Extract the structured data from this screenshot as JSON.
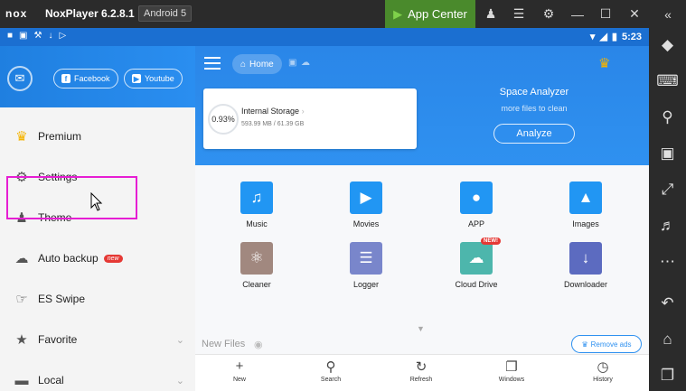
{
  "titlebar": {
    "logo": "nox",
    "title": "NoxPlayer 6.2.8.1",
    "android": "Android 5",
    "app_center": "App Center",
    "icons": [
      "tshirt-icon",
      "menu-icon",
      "gear-icon",
      "minimize-icon",
      "maximize-icon",
      "close-icon",
      "collapse-icon"
    ]
  },
  "status_bar": {
    "time": "5:23"
  },
  "drawer": {
    "social": [
      {
        "label": "Facebook"
      },
      {
        "label": "Youtube"
      }
    ],
    "items": [
      {
        "label": "Premium",
        "icon": "crown-icon"
      },
      {
        "label": "Settings",
        "icon": "gear-icon"
      },
      {
        "label": "Theme",
        "icon": "tshirt-icon"
      },
      {
        "label": "Auto backup",
        "icon": "cloud-icon",
        "badge": "new"
      },
      {
        "label": "ES Swipe",
        "icon": "swipe-icon"
      },
      {
        "label": "Favorite",
        "icon": "star-icon",
        "expandable": true
      },
      {
        "label": "Local",
        "icon": "folder-icon",
        "expandable": true
      }
    ]
  },
  "main": {
    "home_label": "Home",
    "storage": {
      "percent": "0.93%",
      "title": "Internal Storage",
      "size": "593.99 MB / 61.39 GB",
      "fraction": 0.0093
    },
    "analyzer": {
      "title": "Space Analyzer",
      "subtitle": "more files to clean",
      "button": "Analyze"
    },
    "grid": [
      {
        "label": "Music",
        "color": "#2196f3"
      },
      {
        "label": "Movies",
        "color": "#2196f3"
      },
      {
        "label": "APP",
        "color": "#2196f3"
      },
      {
        "label": "Images",
        "color": "#2196f3"
      },
      {
        "label": "Cleaner",
        "color": "#a1887f"
      },
      {
        "label": "Logger",
        "color": "#7986cb"
      },
      {
        "label": "Cloud Drive",
        "color": "#4db6ac",
        "badge": "NEW!"
      },
      {
        "label": "Downloader",
        "color": "#5c6bc0"
      }
    ],
    "new_files": "New Files",
    "remove_ads": "Remove ads"
  },
  "bottom_bar": [
    {
      "label": "New"
    },
    {
      "label": "Search"
    },
    {
      "label": "Refresh"
    },
    {
      "label": "Windows"
    },
    {
      "label": "History"
    }
  ],
  "colors": {
    "accent": "#2f91f0",
    "highlight": "#e61ed3",
    "nox_green": "#4a8a2c"
  }
}
